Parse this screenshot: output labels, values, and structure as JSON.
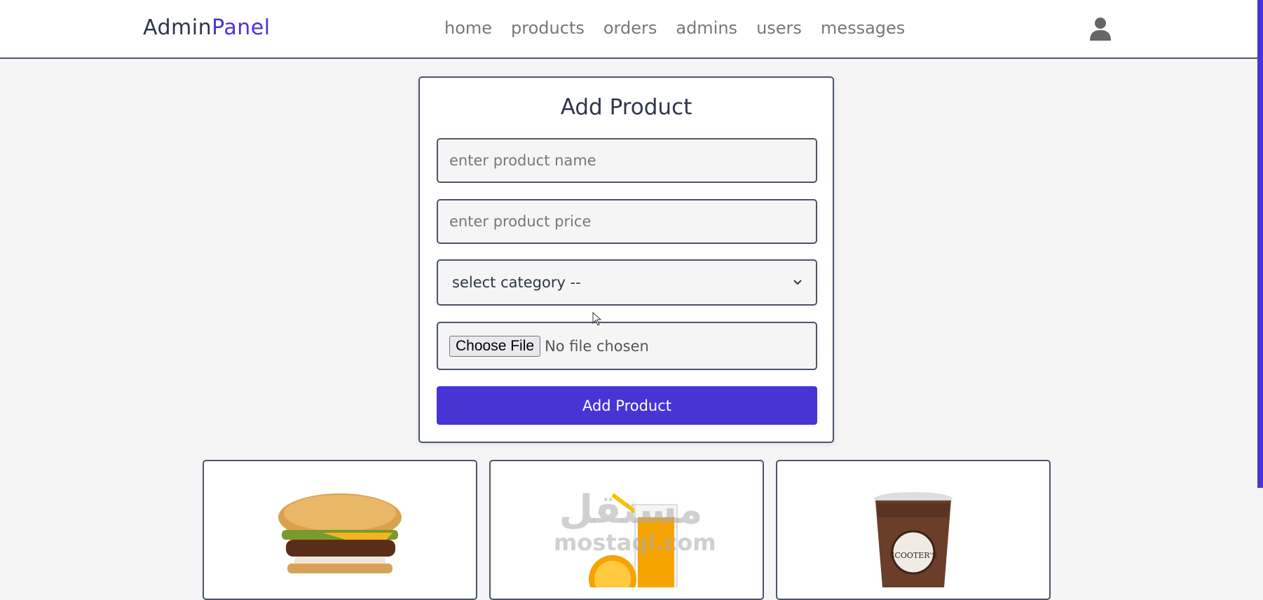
{
  "header": {
    "logo_primary": "Admin",
    "logo_accent": "Panel",
    "nav": [
      "home",
      "products",
      "orders",
      "admins",
      "users",
      "messages"
    ],
    "user_icon": "user-icon"
  },
  "form": {
    "title": "Add Product",
    "name_placeholder": "enter product name",
    "price_placeholder": "enter product price",
    "category_selected": "select category --",
    "file_button": "Choose File",
    "file_status": "No file chosen",
    "submit_label": "Add Product"
  },
  "products": [
    {
      "image": "burger"
    },
    {
      "image": "orange-juice"
    },
    {
      "image": "coffee-cup",
      "brand_text": "SCOOTER'S"
    }
  ],
  "watermark": {
    "arabic": "مستقل",
    "latin": "mostaql.com"
  },
  "colors": {
    "accent": "#4834d4",
    "border": "#4a5568",
    "background": "#f5f5f5"
  }
}
